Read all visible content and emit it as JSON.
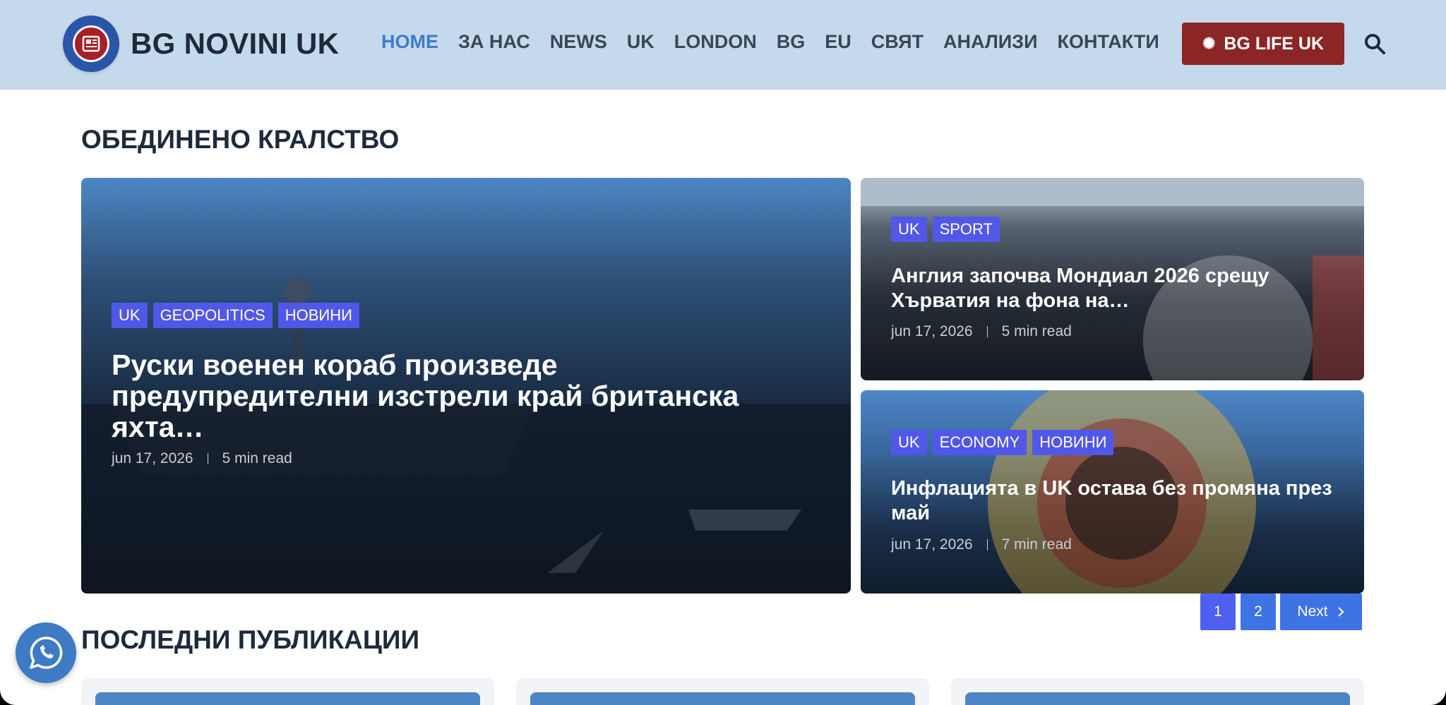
{
  "header": {
    "brand": "BG NOVINI UK",
    "nav": [
      "HOME",
      "ЗА НАС",
      "NEWS",
      "UK",
      "LONDON",
      "BG",
      "EU",
      "СВЯТ",
      "АНАЛИЗИ",
      "КОНТАКТИ"
    ],
    "active_nav": "HOME",
    "cta_label": "BG LIFE UK"
  },
  "section_uk": {
    "heading": "ОБЕДИНЕНО КРАЛСТВО",
    "main": {
      "tags": [
        "UK",
        "GEOPOLITICS",
        "НОВИНИ"
      ],
      "title": "Руски военен кораб произведе предупредителни изстрели край британска яхта…",
      "date": "jun 17, 2026",
      "read": "5 min read"
    },
    "side": [
      {
        "tags": [
          "UK",
          "SPORT"
        ],
        "title": "Англия започва Мондиал 2026 срещу Хърватия на фона на…",
        "date": "jun 17, 2026",
        "read": "5 min read"
      },
      {
        "tags": [
          "UK",
          "ECONOMY",
          "НОВИНИ"
        ],
        "title": "Инфлацията в UK остава без промяна през май",
        "date": "jun 17, 2026",
        "read": "7 min read"
      }
    ]
  },
  "pagination": {
    "pages": [
      "1",
      "2"
    ],
    "next_label": "Next"
  },
  "section_latest": {
    "heading": "ПОСЛЕДНИ ПУБЛИКАЦИИ"
  },
  "colors": {
    "header_bg": "#c5d9ec",
    "accent": "#3f7ccc",
    "tag": "#5158e8",
    "cta": "#8c2626"
  },
  "icons": {
    "search": "search-icon",
    "whatsapp": "whatsapp-icon",
    "cta": "sun-icon"
  }
}
